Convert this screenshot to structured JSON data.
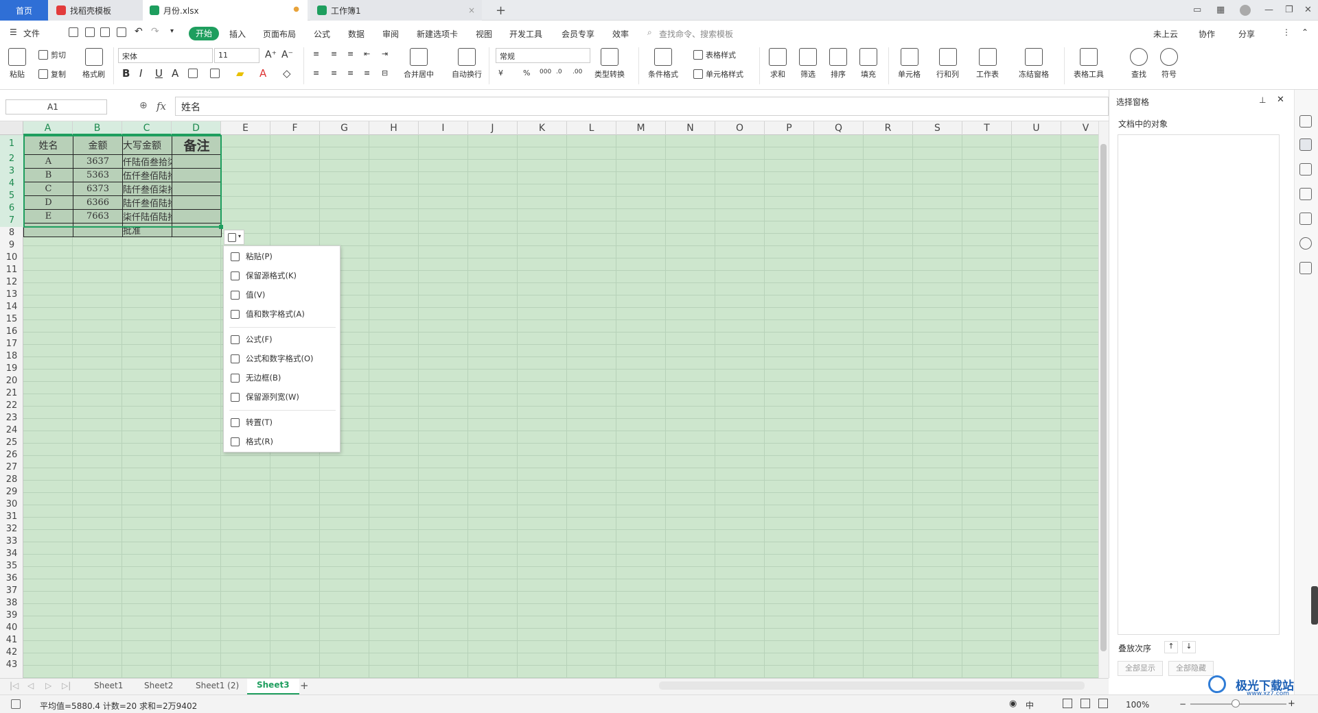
{
  "tabs": {
    "home": "首页",
    "templates": "找稻壳模板",
    "file": "月份.xlsx",
    "book1": "工作簿1",
    "new": "+"
  },
  "menus": [
    "文件",
    "开始",
    "插入",
    "页面布局",
    "公式",
    "数据",
    "审阅",
    "新建选项卡",
    "视图",
    "开发工具",
    "会员专享",
    "效率"
  ],
  "search_placeholder": "查找命令、搜索模板",
  "top_right": {
    "cloud": "未上云",
    "collab": "协作",
    "share": "分享"
  },
  "ribbon": {
    "paste": "粘贴",
    "cut": "剪切",
    "copy": "复制",
    "format_painter": "格式刷",
    "font_name": "宋体",
    "font_size": "11",
    "merge": "合并居中",
    "wrap": "自动换行",
    "num_format": "常规",
    "type_convert": "类型转换",
    "cond_format": "条件格式",
    "table_style": "表格样式",
    "cell_style": "单元格样式",
    "sum": "求和",
    "filter": "筛选",
    "sort": "排序",
    "fill": "填充",
    "cell": "单元格",
    "rowcol": "行和列",
    "worksheet": "工作表",
    "freeze": "冻结窗格",
    "table_tools": "表格工具",
    "find": "查找",
    "symbol": "符号"
  },
  "namebox": "A1",
  "formula": "姓名",
  "columns": [
    "A",
    "B",
    "C",
    "D",
    "E",
    "F",
    "G",
    "H",
    "I",
    "J",
    "K",
    "L",
    "M",
    "N",
    "O",
    "P",
    "Q",
    "R",
    "S",
    "T",
    "U",
    "V"
  ],
  "rows": [
    "1",
    "2",
    "3",
    "4",
    "5",
    "6",
    "7",
    "8",
    "9",
    "10",
    "11",
    "12",
    "13",
    "14",
    "15",
    "16",
    "17",
    "18",
    "19",
    "20",
    "21",
    "22",
    "23",
    "24",
    "25",
    "26",
    "27",
    "28",
    "29",
    "30",
    "31",
    "32",
    "33",
    "34",
    "35",
    "36",
    "37",
    "38",
    "39",
    "40",
    "41",
    "42",
    "43"
  ],
  "table": {
    "header": [
      "姓名",
      "金额",
      "大写金额",
      "备注"
    ],
    "rows": [
      [
        "A",
        "3637",
        "仟陆佰叁拾柒",
        ""
      ],
      [
        "B",
        "5363",
        "伍仟叁佰陆拾叁",
        ""
      ],
      [
        "C",
        "6373",
        "陆仟叁佰柒拾叁",
        ""
      ],
      [
        "D",
        "6366",
        "陆仟叁佰陆拾陆",
        ""
      ],
      [
        "E",
        "7663",
        "柒仟陆佰陆拾叁",
        ""
      ],
      [
        "",
        "",
        "批准",
        ""
      ]
    ]
  },
  "paste_menu": [
    "粘贴(P)",
    "保留源格式(K)",
    "值(V)",
    "值和数字格式(A)",
    "公式(F)",
    "公式和数字格式(O)",
    "无边框(B)",
    "保留源列宽(W)",
    "转置(T)",
    "格式(R)"
  ],
  "sheets": [
    "Sheet1",
    "Sheet2",
    "Sheet1 (2)",
    "Sheet3"
  ],
  "active_sheet": "Sheet3",
  "status": "平均值=5880.4  计数=20  求和=2万9402",
  "zoom": "100%",
  "input_mode": "中",
  "pane": {
    "title": "选择窗格",
    "objects": "文档中的对象",
    "order": "叠放次序",
    "show_all": "全部显示",
    "hide_all": "全部隐藏"
  },
  "watermark": "极光下载站",
  "watermark_url": "www.xz7.com",
  "colors": {
    "accent": "#1e9e5e",
    "cell_bg": "#cde6cd",
    "home_tab": "#2f6fd6"
  }
}
